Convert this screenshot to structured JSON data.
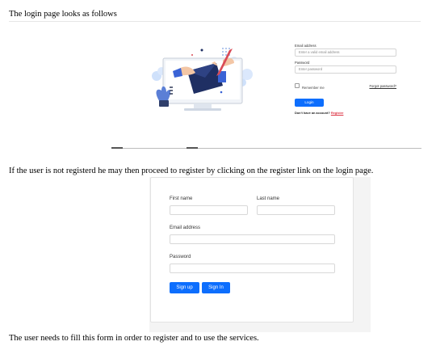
{
  "paragraphs": {
    "intro": "The login page looks as follows",
    "register_info": "If the user is not registerd he may then proceed to register by clicking on the register link on the login page.",
    "closing": "The user needs to fill this form in order to register and to use the services."
  },
  "login_screenshot": {
    "email_label": "Email address",
    "email_placeholder": "Enter a valid email address",
    "password_label": "Password",
    "password_placeholder": "Enter password",
    "remember_label": "Remember me",
    "forgot_link": "Forgot password?",
    "login_button": "Login",
    "no_account_text": "Don't have an account?",
    "register_link": "Register",
    "accent_color": "#0d6efd",
    "link_color": "#dc3545"
  },
  "register_screenshot": {
    "first_name_label": "First name",
    "last_name_label": "Last name",
    "email_label": "Email address",
    "password_label": "Password",
    "signup_button": "Sign up",
    "signin_button": "Sign In",
    "accent_color": "#0d6efd"
  },
  "icons": [
    "login-illustration"
  ]
}
